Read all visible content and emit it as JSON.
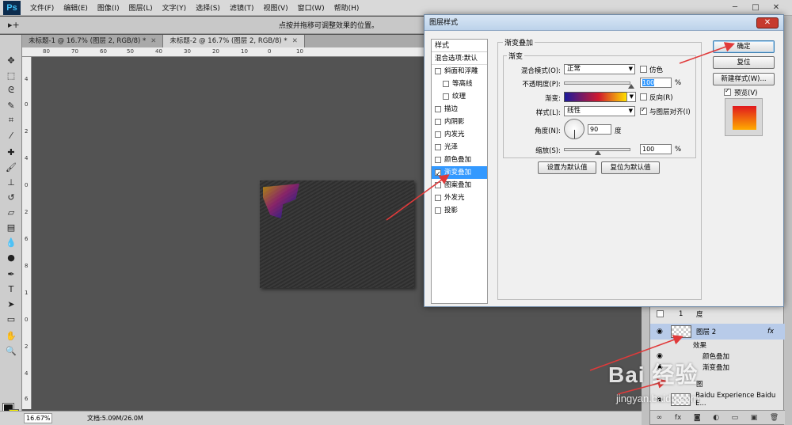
{
  "menubar": {
    "logo": "Ps",
    "items": [
      "文件(F)",
      "编辑(E)",
      "图像(I)",
      "图层(L)",
      "文字(Y)",
      "选择(S)",
      "滤镜(T)",
      "视图(V)",
      "窗口(W)",
      "帮助(H)"
    ]
  },
  "options": {
    "tool": "▸+",
    "hint": "点按并拖移可调整效果的位置。"
  },
  "tabs": [
    {
      "label": "未标题-1 @ 16.7% (图层 2, RGB/8) *"
    },
    {
      "label": "未标题-2 @ 16.7% (图层 2, RGB/8) *"
    }
  ],
  "ruler_h": [
    "80",
    "70",
    "60",
    "50",
    "40",
    "30",
    "20",
    "10",
    "0",
    "10"
  ],
  "ruler_v": [
    "4",
    "0",
    "2",
    "4",
    "0",
    "2",
    "6",
    "8",
    "1",
    "0",
    "2",
    "4",
    "6"
  ],
  "status": {
    "zoom": "16.67%",
    "doc": "文档:5.09M/26.0M"
  },
  "dialog": {
    "title": "图层样式",
    "close": "✕",
    "list_header": "样式",
    "blend_default": "混合选项:默认",
    "items": [
      {
        "label": "斜面和浮雕",
        "sub": false,
        "checked": false
      },
      {
        "label": "等高线",
        "sub": true,
        "checked": false
      },
      {
        "label": "纹理",
        "sub": true,
        "checked": false
      },
      {
        "label": "描边",
        "sub": false,
        "checked": false
      },
      {
        "label": "内阴影",
        "sub": false,
        "checked": false
      },
      {
        "label": "内发光",
        "sub": false,
        "checked": false
      },
      {
        "label": "光泽",
        "sub": false,
        "checked": false
      },
      {
        "label": "颜色叠加",
        "sub": false,
        "checked": false
      },
      {
        "label": "渐变叠加",
        "sub": false,
        "checked": true,
        "active": true
      },
      {
        "label": "图案叠加",
        "sub": false,
        "checked": false
      },
      {
        "label": "外发光",
        "sub": false,
        "checked": false
      },
      {
        "label": "投影",
        "sub": false,
        "checked": false
      }
    ],
    "section_title": "渐变叠加",
    "subsection_title": "渐变",
    "blend_mode_label": "混合模式(O):",
    "blend_mode_value": "正常",
    "dither_label": "仿色",
    "opacity_label": "不透明度(P):",
    "opacity_value": "100",
    "opacity_fraction": 1.0,
    "percent": "%",
    "gradient_label": "渐变:",
    "reverse_label": "反向(R)",
    "style_label": "样式(L):",
    "style_value": "线性",
    "align_label": "与图层对齐(I)",
    "angle_label": "角度(N):",
    "angle_value": "90",
    "degree": "度",
    "scale_label": "缩放(S):",
    "scale_value": "100",
    "scale_fraction": 0.33,
    "set_default": "设置为默认值",
    "reset_default": "复位为默认值",
    "ok": "确定",
    "reset": "复位",
    "new_style": "新建样式(W)...",
    "preview_label": "预览(V)"
  },
  "layers": {
    "row1": "度",
    "row1_num": "1",
    "layer_name": "图层 2",
    "fx": "fx",
    "effects": "效果",
    "effect_color": "颜色叠加",
    "effect_other": "渐变叠加",
    "row_mid": "图",
    "bottom_layer": "Baidu Experience Baidu E...",
    "bottom_icons": [
      "∞",
      "fx",
      "◙",
      "◐",
      "▭",
      "▣",
      "🗑"
    ]
  },
  "watermark": {
    "main": "Bai 经验",
    "sub": "jingyan.baidu.com"
  },
  "colors": {
    "accent": "#3399ff",
    "arrow": "#e03a3a",
    "fg": "#111111",
    "bg": "#f4f000"
  }
}
